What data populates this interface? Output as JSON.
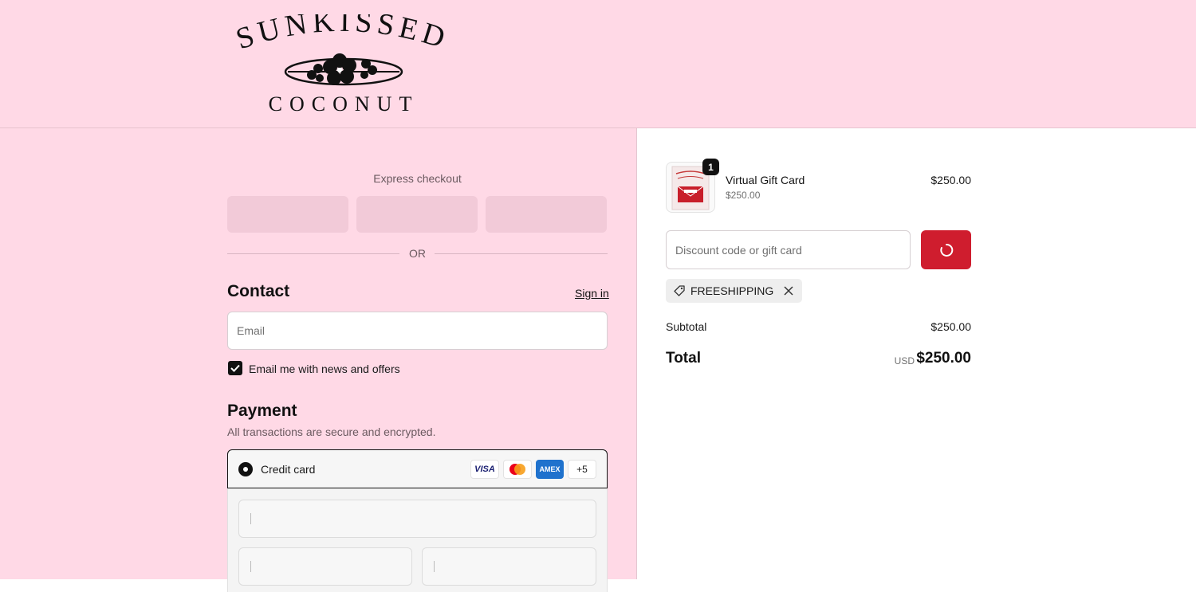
{
  "brand": {
    "logo_top_text": "SUNKISSED",
    "logo_bottom_text": "COCONUT"
  },
  "express": {
    "label": "Express checkout",
    "or_text": "OR"
  },
  "contact": {
    "title": "Contact",
    "sign_in": "Sign in",
    "email_placeholder": "Email",
    "newsletter_label": "Email me with news and offers",
    "newsletter_checked": true
  },
  "payment": {
    "title": "Payment",
    "subtitle": "All transactions are secure and encrypted.",
    "method_label": "Credit card",
    "card_logos": [
      "VISA",
      "mastercard",
      "AMEX"
    ],
    "more_cards": "+5"
  },
  "summary": {
    "item": {
      "name": "Virtual Gift Card",
      "unit_price": "$250.00",
      "price": "$250.00",
      "quantity": "1"
    },
    "discount_placeholder": "Discount code or gift card",
    "applied_code": "FREESHIPPING",
    "subtotal_label": "Subtotal",
    "subtotal_value": "$250.00",
    "total_label": "Total",
    "currency": "USD",
    "total_value": "$250.00"
  },
  "colors": {
    "page_bg": "#ffd9e6",
    "accent": "#cf1d2e",
    "express_button": "#f2cad8"
  }
}
